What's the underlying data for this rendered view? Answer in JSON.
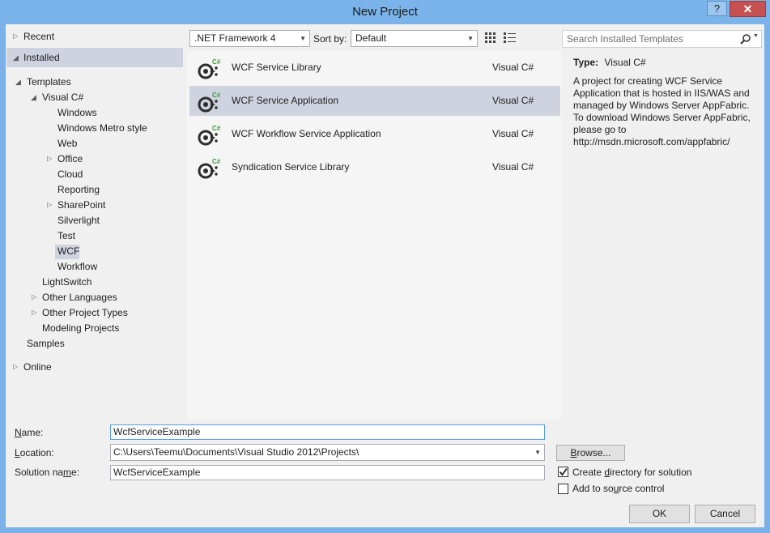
{
  "window": {
    "title": "New Project",
    "help_label": "?",
    "close_label": "✕"
  },
  "tree": {
    "recent": "Recent",
    "installed": "Installed",
    "templates": "Templates",
    "visual_csharp": "Visual C#",
    "children": [
      "Windows",
      "Windows Metro style",
      "Web",
      "Office",
      "Cloud",
      "Reporting",
      "SharePoint",
      "Silverlight",
      "Test",
      "WCF",
      "Workflow"
    ],
    "lightswitch": "LightSwitch",
    "other_languages": "Other Languages",
    "other_project_types": "Other Project Types",
    "modeling_projects": "Modeling Projects",
    "samples": "Samples",
    "online": "Online"
  },
  "toolbar": {
    "framework": ".NET Framework 4",
    "sort_label": "Sort by:",
    "sort_value": "Default"
  },
  "search": {
    "placeholder": "Search Installed Templates"
  },
  "templates": [
    {
      "name": "WCF Service Library",
      "lang": "Visual C#"
    },
    {
      "name": "WCF Service Application",
      "lang": "Visual C#"
    },
    {
      "name": "WCF Workflow Service Application",
      "lang": "Visual C#"
    },
    {
      "name": "Syndication Service Library",
      "lang": "Visual C#"
    }
  ],
  "info": {
    "type_label": "Type:",
    "type_value": "Visual C#",
    "description": "A project for creating WCF Service Application that is hosted in IIS/WAS and managed by Windows Server AppFabric. To download Windows Server AppFabric, please go to http://msdn.microsoft.com/appfabric/"
  },
  "form": {
    "name_label": "Name:",
    "name_value": "WcfServiceExample",
    "location_label": "Location:",
    "location_value": "C:\\Users\\Teemu\\Documents\\Visual Studio 2012\\Projects\\",
    "solution_label": "Solution name:",
    "solution_value": "WcfServiceExample",
    "browse_label": "Browse...",
    "create_dir_label": "Create directory for solution",
    "create_dir_checked": true,
    "source_control_label": "Add to source control",
    "source_control_checked": false,
    "ok_label": "OK",
    "cancel_label": "Cancel"
  }
}
